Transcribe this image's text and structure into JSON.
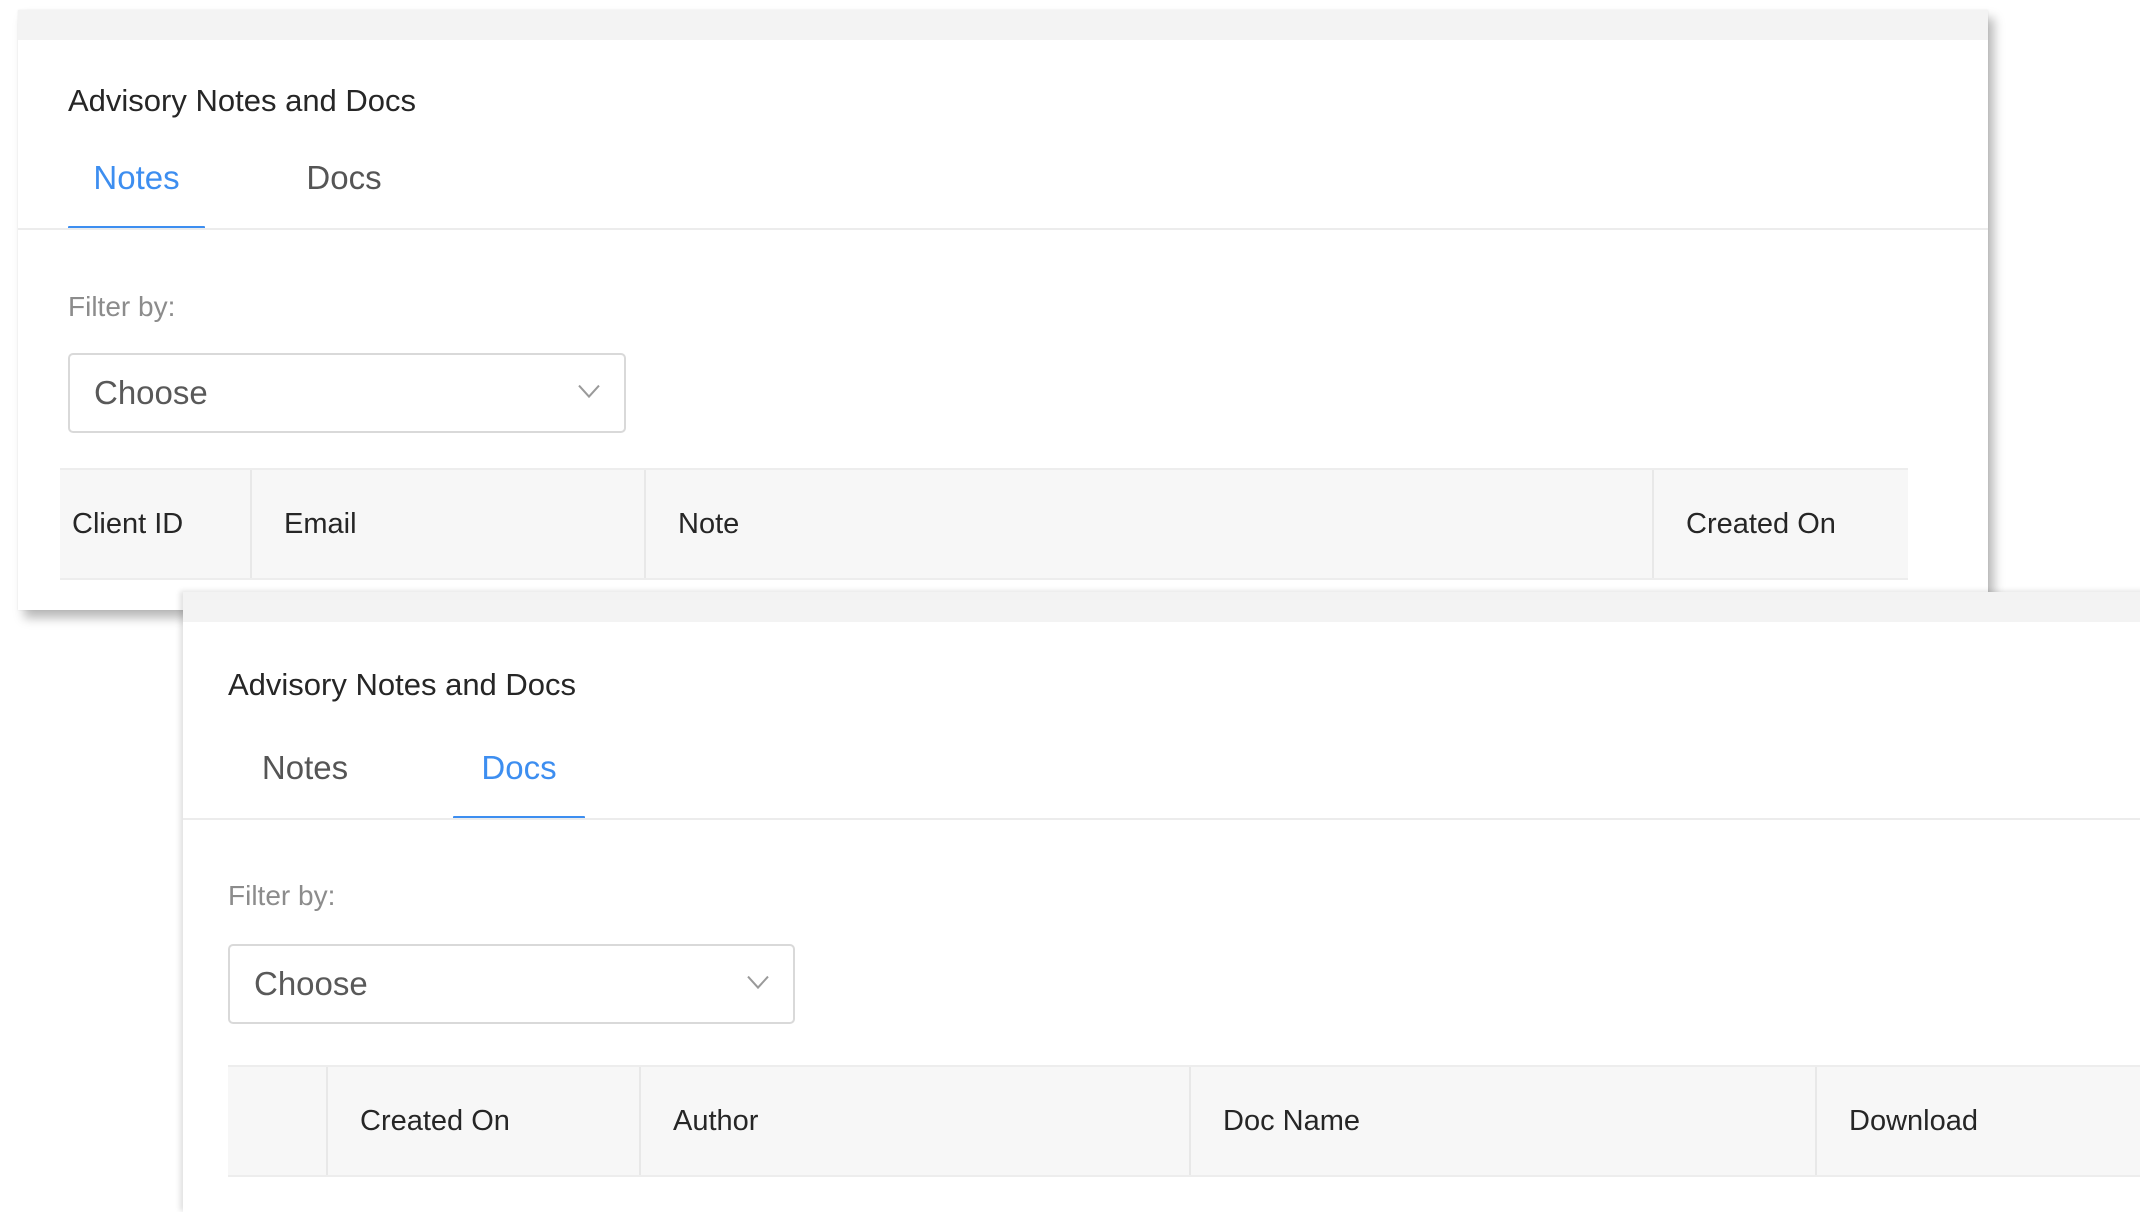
{
  "panels": {
    "notes": {
      "title": "Advisory Notes and Docs",
      "tabs": [
        {
          "label": "Notes",
          "active": true
        },
        {
          "label": "Docs",
          "active": false
        }
      ],
      "filter_label": "Filter by:",
      "select": {
        "value": "Choose"
      },
      "columns": [
        "Client ID",
        "Email",
        "Note",
        "Created On"
      ]
    },
    "docs": {
      "title": "Advisory Notes and Docs",
      "tabs": [
        {
          "label": "Notes",
          "active": false
        },
        {
          "label": "Docs",
          "active": true
        }
      ],
      "filter_label": "Filter by:",
      "select": {
        "value": "Choose"
      },
      "columns": [
        "",
        "Created On",
        "Author",
        "Doc Name",
        "Download"
      ]
    }
  },
  "colors": {
    "accent": "#3d8ef0",
    "text": "#262626",
    "muted": "#8c8c8c",
    "header_bg": "#f7f7f7"
  },
  "icons": {
    "select_arrow": "chevron-down-icon"
  }
}
